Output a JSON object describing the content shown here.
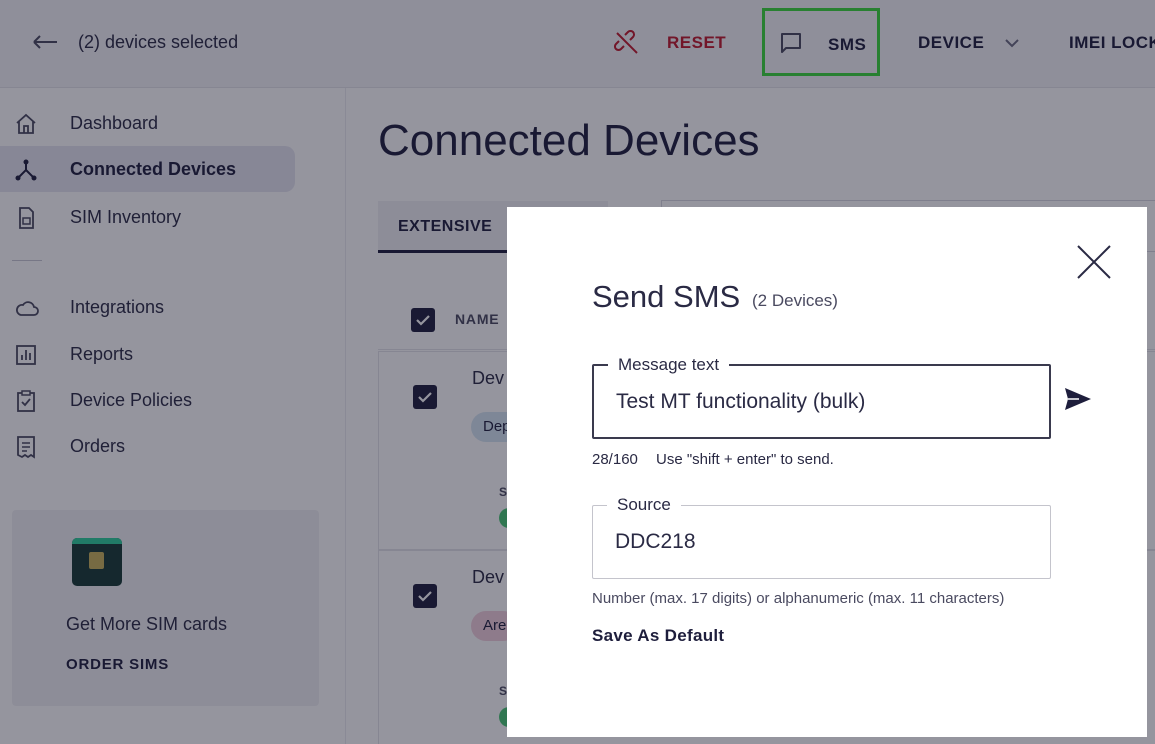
{
  "topbar": {
    "selected_text": "(2) devices selected",
    "reset_label": "RESET",
    "sms_label": "SMS",
    "device_label": "DEVICE",
    "imei_label": "IMEI LOCK"
  },
  "sidebar": {
    "items": [
      {
        "label": "Dashboard",
        "icon": "home-icon"
      },
      {
        "label": "Connected Devices",
        "icon": "network-icon",
        "active": true
      },
      {
        "label": "SIM Inventory",
        "icon": "sim-card-icon"
      },
      {
        "label": "Integrations",
        "icon": "cloud-icon"
      },
      {
        "label": "Reports",
        "icon": "bar-chart-icon"
      },
      {
        "label": "Device Policies",
        "icon": "clipboard-check-icon"
      },
      {
        "label": "Orders",
        "icon": "receipt-icon"
      }
    ],
    "promo": {
      "title": "Get More SIM cards",
      "link": "ORDER SIMS"
    }
  },
  "main": {
    "title": "Connected Devices",
    "tab_label": "EXTENSIVE",
    "column_name": "NAME",
    "rows": [
      {
        "name": "Dev",
        "tag": "Dep",
        "sub": "S"
      },
      {
        "name": "Dev",
        "tag": "Are",
        "sub": "S"
      }
    ]
  },
  "modal": {
    "title": "Send SMS",
    "subtitle": "(2 Devices)",
    "message_legend": "Message text",
    "message_value": "Test MT functionality (bulk)",
    "counter": "28/160",
    "hint": "Use \"shift + enter\" to send.",
    "source_legend": "Source",
    "source_value": "DDC218",
    "source_hint": "Number (max. 17 digits) or alphanumeric (max. 11 characters)",
    "save_default": "Save As Default"
  },
  "colors": {
    "accent": "#1e1e3c",
    "danger": "#c0182b",
    "highlight": "#3ad93a",
    "status_green": "#48c774"
  }
}
